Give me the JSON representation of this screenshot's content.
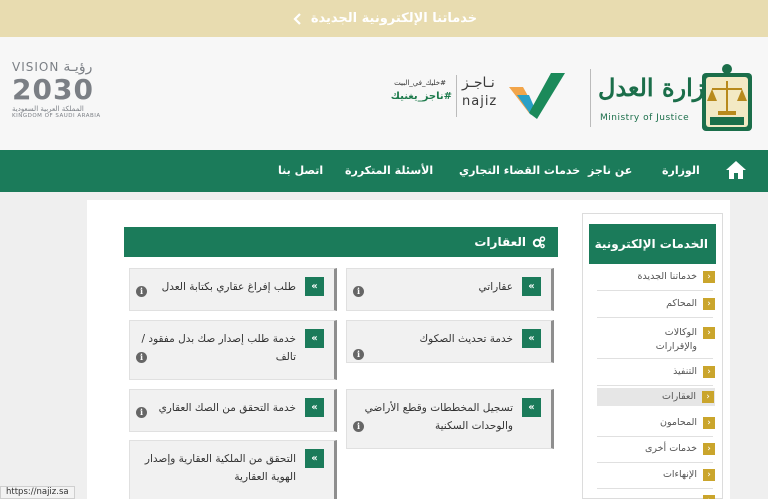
{
  "announcement": {
    "text": "خدماتنا الإلكترونية الجديدة"
  },
  "header": {
    "vision": {
      "word": "VISION",
      "arabic": "رؤيـة",
      "year": "2030",
      "kingdom_ar": "المملكة العربية السعودية",
      "kingdom_en": "KINGDOM OF SAUDI ARABIA"
    },
    "najiz": {
      "tagline": "#خليك_في_البيت",
      "hashtag": "#ناجز_يغنيك",
      "name_ar": "نـاجـز",
      "name_en": "najiz"
    },
    "ministry": {
      "name_ar": "وزارة العدل",
      "name_en": "Ministry of Justice"
    }
  },
  "nav": {
    "items": [
      "الوزارة",
      "عن ناجز",
      "خدمات القضاء التجاري",
      "الأسئلة المتكررة",
      "اتصل بنا"
    ]
  },
  "sidebar": {
    "title": "الخدمات الإلكترونية",
    "items": [
      {
        "label": "خدماتنا الجديدة"
      },
      {
        "label": "المحاكم"
      },
      {
        "label": "الوكالات والإقرارات"
      },
      {
        "label": "التنفيذ"
      },
      {
        "label": "العقارات",
        "active": true
      },
      {
        "label": "المحامون"
      },
      {
        "label": "خدمات أخرى"
      },
      {
        "label": "الإنهاءات"
      }
    ]
  },
  "main": {
    "title": "العقارات",
    "cards": [
      {
        "title": "عقاراتي"
      },
      {
        "title": "طلب إفراغ عقاري بكتابة العدل"
      },
      {
        "title": "خدمة تحديث الصكوك"
      },
      {
        "title": "خدمة طلب إصدار صك بدل مفقود / تالف"
      },
      {
        "title": "تسجيل المخططات وقطع الأراضي والوحدات السكنية"
      },
      {
        "title": "خدمة التحقق من الصك العقاري"
      },
      {
        "title": "التحقق من الملكية العقارية وإصدار الهوية العقارية"
      }
    ]
  },
  "status_bar": {
    "url": "https://najiz.sa"
  },
  "colors": {
    "primary_green": "#1b7b5a",
    "gold": "#caa52c",
    "announcement_bg": "#e8dcb0"
  }
}
